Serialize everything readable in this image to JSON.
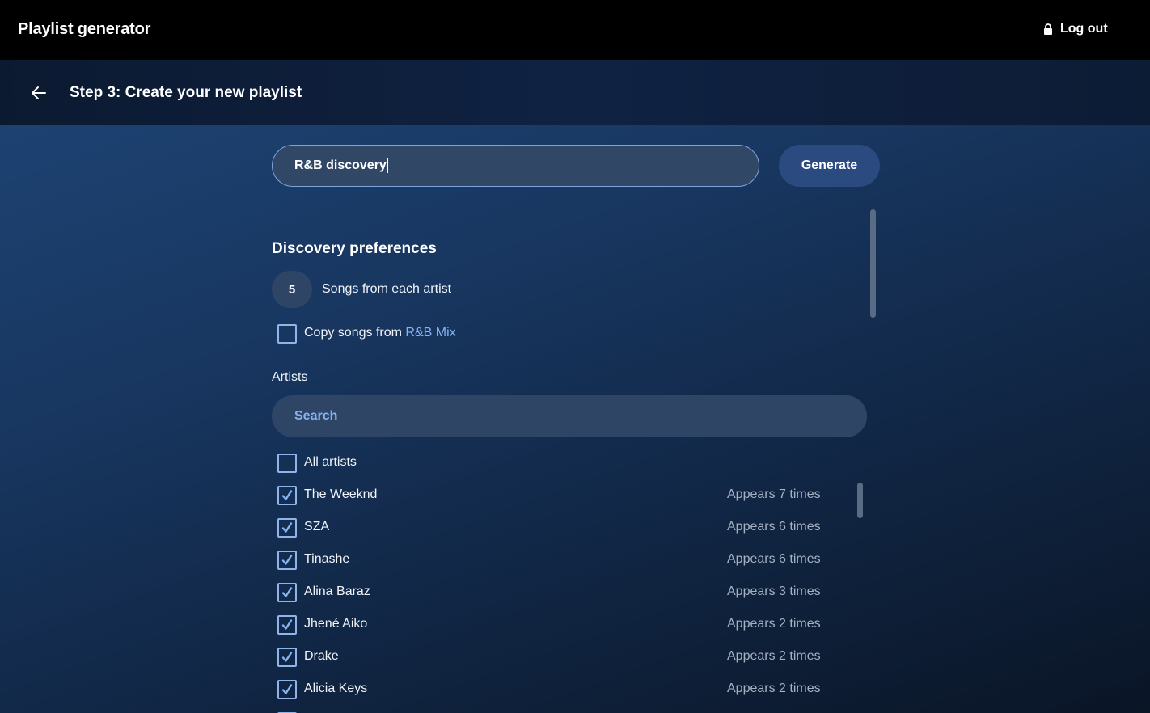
{
  "app": {
    "title": "Playlist generator",
    "logout_label": "Log out"
  },
  "step": {
    "title": "Step 3: Create your new playlist"
  },
  "playlist_name": {
    "value": "R&B discovery"
  },
  "generate_label": "Generate",
  "preferences": {
    "title": "Discovery preferences",
    "songs_per_artist": "5",
    "songs_per_artist_label": "Songs from each artist",
    "copy_songs_prefix": "Copy songs from ",
    "copy_songs_source": "R&B Mix",
    "copy_songs_checked": false
  },
  "artists": {
    "label": "Artists",
    "search_placeholder": "Search",
    "all_label": "All artists",
    "all_checked": false,
    "items": [
      {
        "name": "The Weeknd",
        "count": "Appears 7 times",
        "checked": true
      },
      {
        "name": "SZA",
        "count": "Appears 6 times",
        "checked": true
      },
      {
        "name": "Tinashe",
        "count": "Appears 6 times",
        "checked": true
      },
      {
        "name": "Alina Baraz",
        "count": "Appears 3 times",
        "checked": true
      },
      {
        "name": "Jhené Aiko",
        "count": "Appears 2 times",
        "checked": true
      },
      {
        "name": "Drake",
        "count": "Appears 2 times",
        "checked": true
      },
      {
        "name": "Alicia Keys",
        "count": "Appears 2 times",
        "checked": true
      }
    ]
  },
  "icons": {
    "lock": "lock-icon",
    "back": "arrow-left-icon",
    "check": "checkmark-icon"
  },
  "colors": {
    "accent": "#86b3f2",
    "checkbox_border": "#8fb4ea",
    "button_bg": "#2b4a80",
    "input_bg": "#314766"
  }
}
